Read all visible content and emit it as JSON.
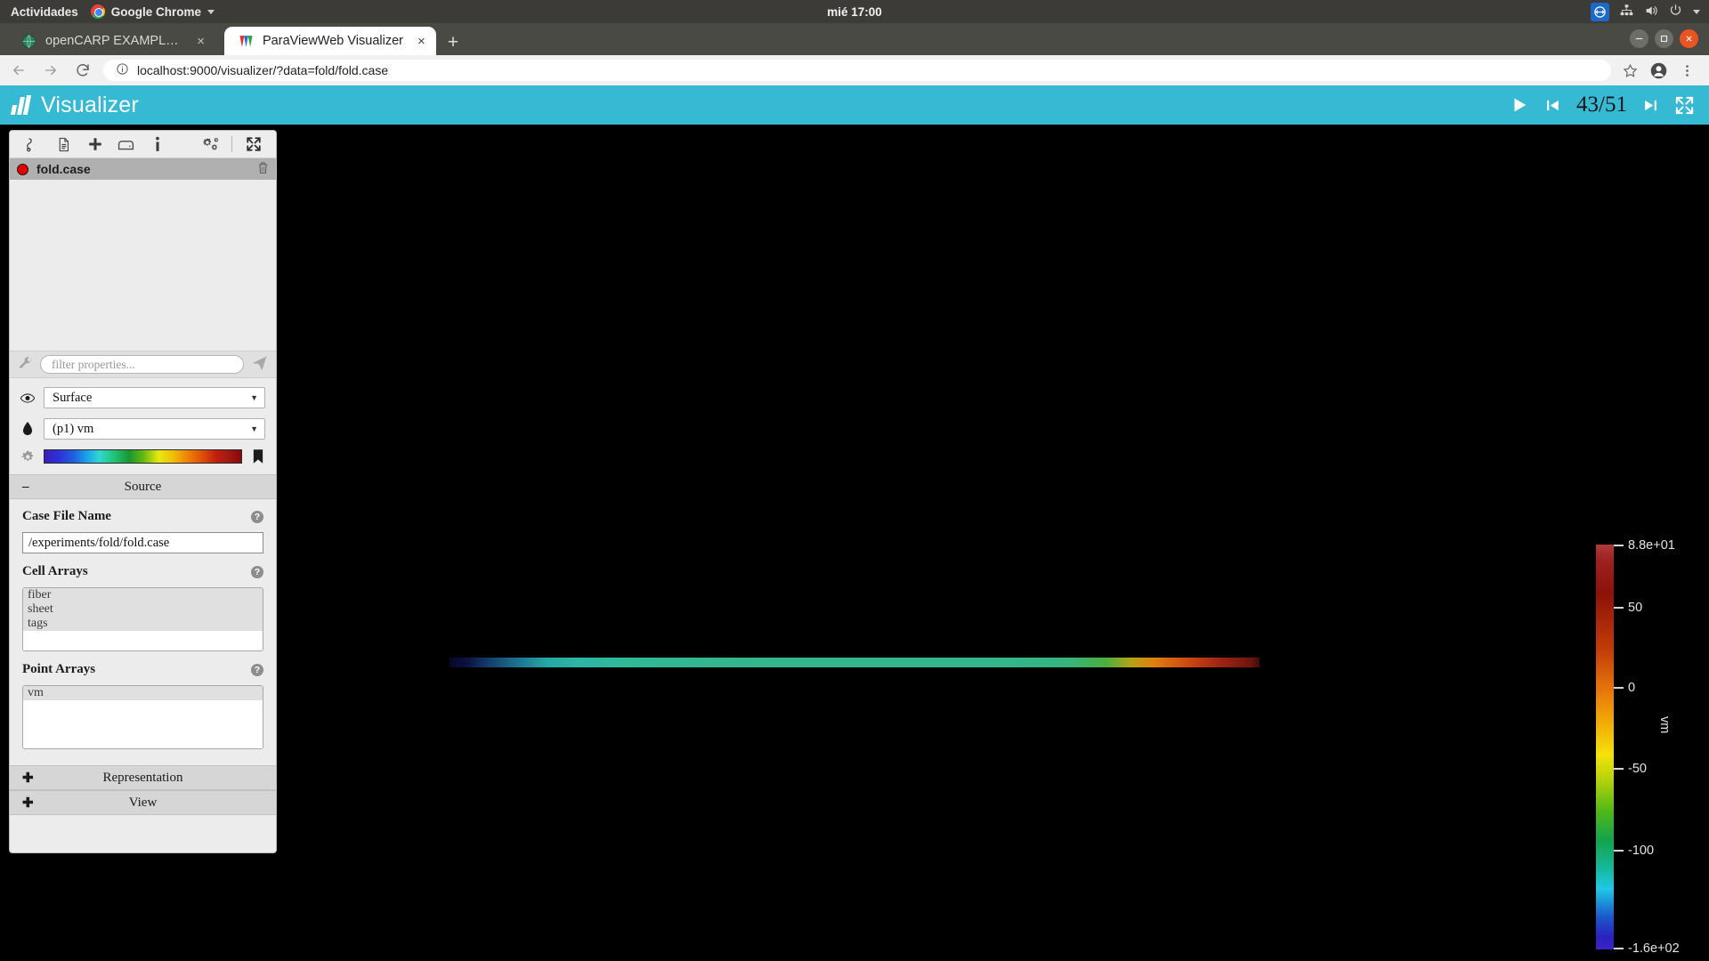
{
  "desktop": {
    "activities_label": "Actividades",
    "app_menu_label": "Google Chrome",
    "clock": "mié 17:00",
    "tray_icons": [
      "teamviewer-icon",
      "network-icon",
      "volume-icon",
      "power-icon",
      "caret-down-icon"
    ]
  },
  "browser": {
    "tabs": [
      {
        "title": "openCARP EXAMPLES",
        "favicon": "globe-icon",
        "active": false
      },
      {
        "title": "ParaViewWeb Visualizer",
        "favicon": "paraview-icon",
        "active": true
      }
    ],
    "new_tab_label": "+",
    "close_label": "×",
    "window_buttons": {
      "minimize": "–",
      "maximize": "□",
      "close": "×"
    },
    "nav": {
      "back": "←",
      "forward": "→",
      "reload": "↻"
    },
    "omnibox": {
      "url": "localhost:9000/visualizer/?data=fold/fold.case",
      "info_icon": "info-circle-icon",
      "bookmark_icon": "star-icon"
    },
    "profile_icon": "account-icon",
    "menu_icon": "three-dot-menu-icon"
  },
  "app": {
    "title": "Visualizer",
    "logo": "visualizer-logo",
    "player": {
      "play_label": "▶",
      "prev_label": "⏮",
      "next_label": "⏭",
      "frame_counter": "43/51",
      "fullscreen_label": "fullscreen-icon"
    },
    "accent_color": "#36b9d3"
  },
  "pipeline": {
    "toolbar_icons": [
      "pointer-icon",
      "file-icon",
      "add-icon",
      "save-icon",
      "info-icon",
      "settings-icon",
      "expand-icon"
    ],
    "items": [
      {
        "name": "fold.case",
        "visible_color": "#e00000",
        "delete_icon": "trash-icon"
      }
    ]
  },
  "properties": {
    "filter": {
      "placeholder": "filter properties...",
      "wrench_icon": "wrench-icon",
      "apply_icon": "apply-icon"
    },
    "representation_select": {
      "value": "Surface",
      "icon": "eye-icon",
      "caret": "▾"
    },
    "coloring_select": {
      "value": "(p1) vm",
      "icon": "droplet-icon",
      "caret": "▾"
    },
    "lut": {
      "gear_icon": "gear-icon",
      "bookmark_icon": "bookmark-icon"
    },
    "sections": [
      {
        "label": "Source",
        "expanded": true,
        "icon": "–"
      },
      {
        "label": "Representation",
        "expanded": false,
        "icon": "✚"
      },
      {
        "label": "View",
        "expanded": false,
        "icon": "✚"
      }
    ],
    "source": {
      "case_file": {
        "label": "Case File Name",
        "value": "/experiments/fold/fold.case",
        "help": "?"
      },
      "cell_arrays": {
        "label": "Cell Arrays",
        "help": "?",
        "items": [
          "fiber",
          "sheet",
          "tags"
        ]
      },
      "point_arrays": {
        "label": "Point Arrays",
        "help": "?",
        "items": [
          "vm"
        ]
      }
    }
  },
  "chart_data": {
    "type": "heatmap",
    "title": "vm",
    "colorbar_label": "vm",
    "ticks": [
      {
        "label": "8.8e+01",
        "value": 88
      },
      {
        "label": "50",
        "value": 50
      },
      {
        "label": "0",
        "value": 0
      },
      {
        "label": "-50",
        "value": -50
      },
      {
        "label": "-100",
        "value": -100
      },
      {
        "label": "-1.6e+02",
        "value": -160
      }
    ],
    "range": [
      -160,
      88
    ],
    "colormap": "Rainbow Desaturated",
    "ylabel": "vm"
  }
}
